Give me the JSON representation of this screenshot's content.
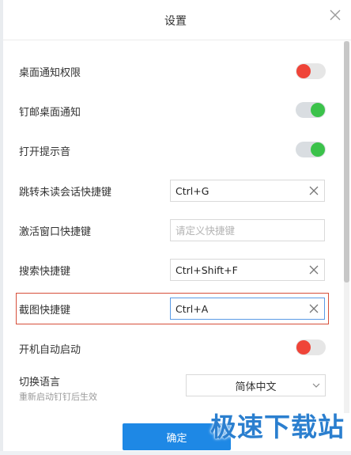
{
  "dialog": {
    "title": "设置",
    "confirm_label": "确定"
  },
  "settings": {
    "desktop_notify": {
      "label": "桌面通知权限",
      "enabled": false
    },
    "mail_notify": {
      "label": "钉邮桌面通知",
      "enabled": true
    },
    "sound": {
      "label": "打开提示音",
      "enabled": true
    },
    "jump_unread": {
      "label": "跳转未读会话快捷键",
      "value": "Ctrl+G"
    },
    "activate_window": {
      "label": "激活窗口快捷键",
      "value": "",
      "placeholder": "请定义快捷键"
    },
    "search": {
      "label": "搜索快捷键",
      "value": "Ctrl+Shift+F"
    },
    "screenshot": {
      "label": "截图快捷键",
      "value": "Ctrl+A"
    },
    "autostart": {
      "label": "开机自动启动",
      "enabled": false
    },
    "language": {
      "label": "切换语言",
      "hint": "重新启动钉钉后生效",
      "selected": "简体中文"
    }
  },
  "watermark": {
    "text": "极速下载站"
  },
  "colors": {
    "toggle_on": "#3bc24a",
    "toggle_off": "#ef4438",
    "primary": "#1e88e5",
    "highlight": "#d64f3a"
  }
}
